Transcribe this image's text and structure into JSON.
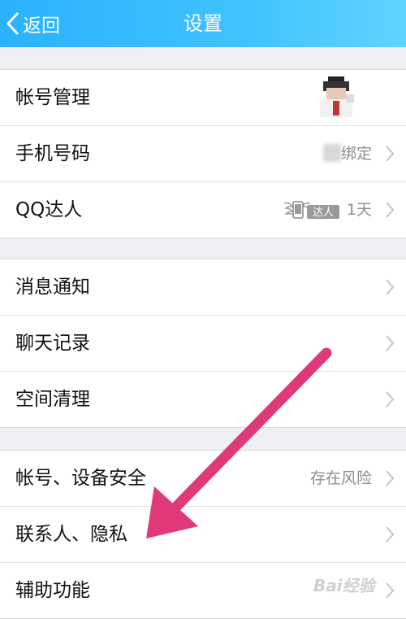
{
  "nav": {
    "back_label": "返回",
    "title": "设置"
  },
  "group1": [
    {
      "label": "帐号管理",
      "value": ""
    },
    {
      "label": "手机号码",
      "value": "绑定"
    },
    {
      "label": "QQ达人",
      "value": "1天",
      "badge": "达人"
    }
  ],
  "group2": [
    {
      "label": "消息通知"
    },
    {
      "label": "聊天记录"
    },
    {
      "label": "空间清理"
    }
  ],
  "group3": [
    {
      "label": "帐号、设备安全",
      "value": "存在风险"
    },
    {
      "label": "联系人、隐私"
    },
    {
      "label": "辅助功能"
    }
  ],
  "watermark": "Bai经验",
  "colors": {
    "nav": "#3ab8ff",
    "annotation_arrow": "#e0397a"
  }
}
